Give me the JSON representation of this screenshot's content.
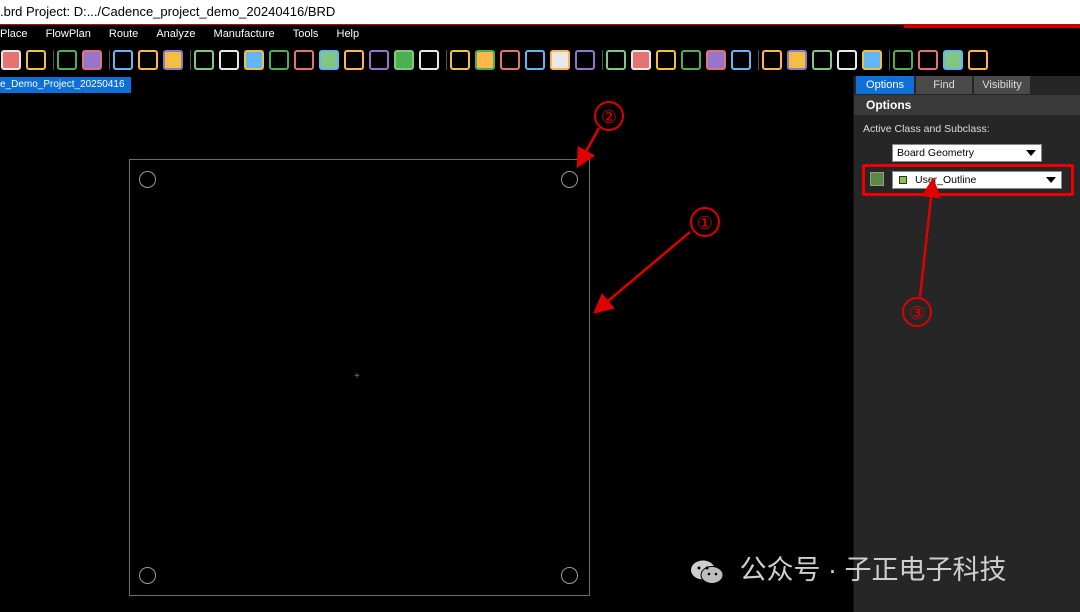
{
  "window": {
    "title": ".brd  Project: D:.../Cadence_project_demo_20240416/BRD"
  },
  "menu": {
    "items": [
      "Place",
      "FlowPlan",
      "Route",
      "Analyze",
      "Manufacture",
      "Tools",
      "Help"
    ]
  },
  "toolbar": {
    "icons": [
      "text-icon",
      "text-edit-icon",
      "add-component-icon",
      "chip-icon",
      "route-icon",
      "hand-icon",
      "swap-icon",
      "unrats-icon",
      "rats-icon",
      "zoom-fit-icon",
      "zoom-window-icon",
      "zoom-in-icon",
      "zoom-out-icon",
      "zoom-prev-icon",
      "zoom-world-icon",
      "redraw-icon",
      "3d-view-icon",
      "grid-icon",
      "color-icon",
      "layers-icon",
      "stack-icon",
      "report-icon",
      "settings-icon",
      "visibility-icon",
      "info-icon",
      "cube-icon",
      "shadow-icon",
      "sun-icon",
      "highlight-icon",
      "shape-add-icon",
      "void-icon",
      "via-icon",
      "select-icon",
      "fill-icon",
      "place-icon",
      "snap-icon",
      "camera-icon",
      "drc-icon"
    ]
  },
  "document": {
    "tab_label": "e_Demo_Project_20250416"
  },
  "panel": {
    "tabs": [
      {
        "label": "Options",
        "active": true
      },
      {
        "label": "Find",
        "active": false
      },
      {
        "label": "Visibility",
        "active": false
      }
    ],
    "title": "Options",
    "active_class_label": "Active Class and Subclass:",
    "class_value": "Board Geometry",
    "subclass_value": "User_Outline",
    "subclass_color": "#5b8a3e"
  },
  "annotations": {
    "labels": [
      "①",
      "②",
      "③"
    ],
    "color": "#e00000"
  },
  "board": {
    "outline_color": "#5f7a48",
    "origin_marker": "+"
  },
  "watermark": {
    "text": "公众号 · 子正电子科技"
  }
}
